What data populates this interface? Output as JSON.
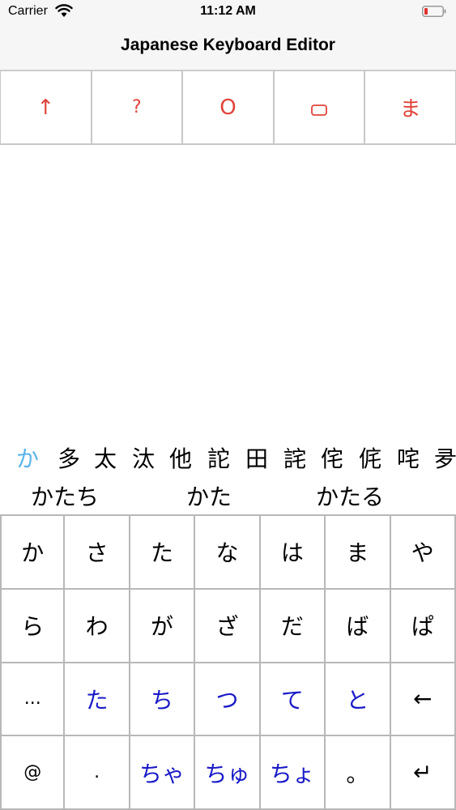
{
  "status_bar": {
    "carrier": "Carrier",
    "time": "11:12 AM"
  },
  "nav": {
    "title": "Japanese Keyboard Editor"
  },
  "toolbar": {
    "buttons": [
      {
        "label": "↑",
        "icon": "up-arrow-icon"
      },
      {
        "label": "?",
        "icon": "question-mark-icon"
      },
      {
        "label": "O",
        "icon": "circle-letter-icon"
      },
      {
        "label": "",
        "icon": "rounded-rectangle-icon"
      },
      {
        "label": "ま",
        "icon": "hiragana-ma-icon"
      }
    ]
  },
  "candidates": {
    "selected": "か",
    "items": [
      "か",
      "多",
      "太",
      "汰",
      "他",
      "詑",
      "田",
      "詫",
      "侘",
      "侂",
      "咤",
      "夛"
    ]
  },
  "predictions": [
    "かたち",
    "かた",
    "かたる"
  ],
  "keyboard": {
    "rows": [
      [
        {
          "label": "か"
        },
        {
          "label": "さ"
        },
        {
          "label": "た"
        },
        {
          "label": "な"
        },
        {
          "label": "は"
        },
        {
          "label": "ま"
        },
        {
          "label": "や"
        }
      ],
      [
        {
          "label": "ら"
        },
        {
          "label": "わ"
        },
        {
          "label": "が"
        },
        {
          "label": "ざ"
        },
        {
          "label": "だ"
        },
        {
          "label": "ば"
        },
        {
          "label": "ぱ"
        }
      ],
      [
        {
          "label": "..."
        },
        {
          "label": "た",
          "highlight": true
        },
        {
          "label": "ち",
          "highlight": true
        },
        {
          "label": "つ",
          "highlight": true
        },
        {
          "label": "て",
          "highlight": true
        },
        {
          "label": "と",
          "highlight": true
        },
        {
          "label": "←"
        }
      ],
      [
        {
          "label": "@"
        },
        {
          "label": "."
        },
        {
          "label": "ちゃ",
          "highlight": true
        },
        {
          "label": "ちゅ",
          "highlight": true
        },
        {
          "label": "ちょ",
          "highlight": true
        },
        {
          "label": "。"
        },
        {
          "label": "↵"
        }
      ]
    ]
  },
  "colors": {
    "accent_red": "#e0443a",
    "highlight_blue": "#1a1ac8",
    "selected_candidate": "#5ab4e8"
  }
}
